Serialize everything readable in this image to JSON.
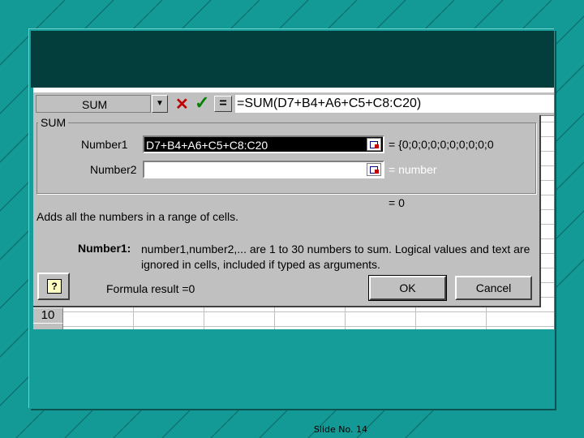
{
  "formula_bar": {
    "name_box": "SUM",
    "name_box_arrow": "▼",
    "cancel_icon": "✕",
    "enter_icon": "✓",
    "equals_label": "=",
    "formula": "=SUM(D7+B4+A6+C5+C8:C20)"
  },
  "dialog": {
    "function_name": "SUM",
    "number1_label": "Number1",
    "number1_value": "D7+B4+A6+C5+C8:C20",
    "number1_result": "= {0;0;0;0;0;0;0;0;0;0",
    "number2_label": "Number2",
    "number2_value": "",
    "number2_result": "= number",
    "total_result": "= 0",
    "description": "Adds all the numbers in a range of cells.",
    "arg_name": "Number1:",
    "arg_description": "number1,number2,... are 1 to 30 numbers to sum. Logical values and text are ignored in cells, included if typed as arguments.",
    "help_label": "?",
    "formula_result": "Formula result =0",
    "ok_label": "OK",
    "cancel_label": "Cancel"
  },
  "sheet": {
    "row_label": "10"
  },
  "footer": {
    "slide_label": "Slide No. 14"
  },
  "colors": {
    "slide_bg": "#149a96",
    "header_dark": "#033e3c",
    "dialog_gray": "#c0c0c0"
  }
}
